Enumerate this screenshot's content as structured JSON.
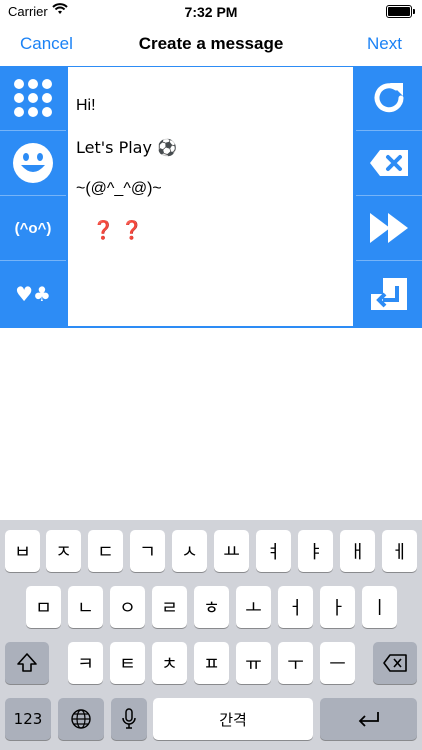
{
  "status": {
    "carrier": "Carrier",
    "time": "7:32 PM",
    "battery_level": 1.0
  },
  "nav": {
    "cancel": "Cancel",
    "title": "Create a message",
    "next": "Next"
  },
  "left_tools": [
    {
      "name": "grid-icon",
      "label": ""
    },
    {
      "name": "smiley-icon",
      "label": ""
    },
    {
      "name": "emoticon-button",
      "label": "(^o^)"
    },
    {
      "name": "symbols-button",
      "label": "♥♣"
    }
  ],
  "right_tools": [
    {
      "name": "refresh-icon"
    },
    {
      "name": "backspace-icon"
    },
    {
      "name": "fast-forward-icon"
    },
    {
      "name": "return-icon"
    }
  ],
  "message": {
    "line1": "Hi!",
    "line2": "Let's Play ⚽",
    "line3": "~(@^_^@)~",
    "line4": "❓ ❓"
  },
  "keyboard": {
    "row1": [
      "ㅂ",
      "ㅈ",
      "ㄷ",
      "ㄱ",
      "ㅅ",
      "ㅛ",
      "ㅕ",
      "ㅑ",
      "ㅐ",
      "ㅔ"
    ],
    "row2": [
      "ㅁ",
      "ㄴ",
      "ㅇ",
      "ㄹ",
      "ㅎ",
      "ㅗ",
      "ㅓ",
      "ㅏ",
      "ㅣ"
    ],
    "row3": [
      "ㅋ",
      "ㅌ",
      "ㅊ",
      "ㅍ",
      "ㅠ",
      "ㅜ",
      "ㅡ"
    ],
    "numbers": "123",
    "space": "간격",
    "shift_icon": "shift-icon",
    "delete_icon": "delete-icon",
    "globe_icon": "globe-icon",
    "mic_icon": "microphone-icon",
    "return_icon": "return-icon"
  }
}
